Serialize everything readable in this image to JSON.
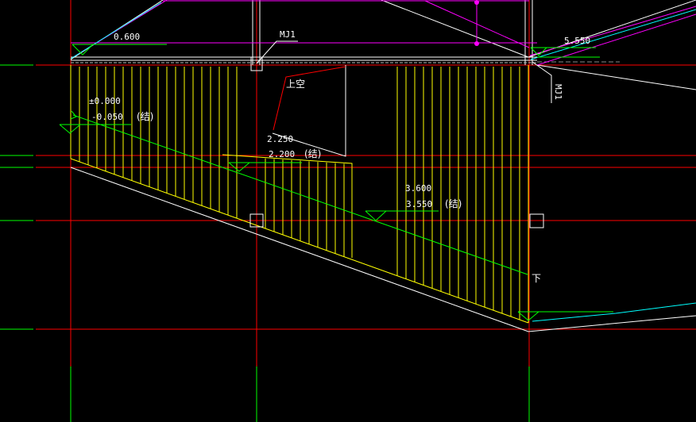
{
  "drawing": {
    "colors": {
      "background": "#000000",
      "grid": "#ff0000",
      "gridExt": "#00ff00",
      "hatch": "#ffff00",
      "outline": "#ffffff",
      "elevation": "#00ff00",
      "roof": "#ff00ff",
      "cyan": "#00ffff",
      "text": "#ffffff"
    },
    "annotations": {
      "elev_0600": "0.600",
      "elev_5550": "5.550",
      "mj1_top": "MJ1",
      "mj1_side": "MJ1",
      "void_label": "上空",
      "elev_pm0000": "±0.000",
      "elev_m0050": "-0.050",
      "struct_1": "(结)",
      "elev_2250": "2.250",
      "elev_2200": "2.200",
      "struct_2": "(结)",
      "elev_3600": "3.600",
      "elev_3550": "3.550",
      "struct_3": "(结)",
      "down_label": "下"
    }
  }
}
